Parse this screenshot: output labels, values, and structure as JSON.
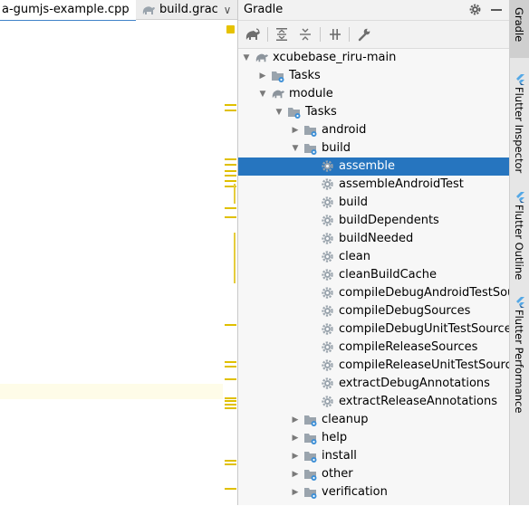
{
  "editor_tabs": [
    {
      "label": "a-gumjs-example.cpp",
      "active": true
    },
    {
      "label": "build.grac",
      "active": false
    }
  ],
  "tab_more_glyph": "∨",
  "gradle_panel": {
    "title": "Gradle",
    "toolbar": [
      "refresh-gradle-icon",
      "expand-all-icon",
      "collapse-all-icon",
      "link-project-icon",
      "gradle-settings-icon"
    ],
    "tree": [
      {
        "label": "xcubebase_riru-main",
        "depth": 0,
        "icon": "gradle-elephant-icon",
        "arrow": "expanded"
      },
      {
        "label": "Tasks",
        "depth": 1,
        "icon": "task-folder-icon",
        "arrow": "collapsed"
      },
      {
        "label": "module",
        "depth": 1,
        "icon": "gradle-elephant-icon",
        "arrow": "expanded"
      },
      {
        "label": "Tasks",
        "depth": 2,
        "icon": "task-folder-icon",
        "arrow": "expanded"
      },
      {
        "label": "android",
        "depth": 3,
        "icon": "task-folder-icon",
        "arrow": "collapsed"
      },
      {
        "label": "build",
        "depth": 3,
        "icon": "task-folder-icon",
        "arrow": "expanded"
      },
      {
        "label": "assemble",
        "depth": 4,
        "icon": "gear-icon",
        "arrow": "none",
        "selected": true
      },
      {
        "label": "assembleAndroidTest",
        "depth": 4,
        "icon": "gear-icon",
        "arrow": "none"
      },
      {
        "label": "build",
        "depth": 4,
        "icon": "gear-icon",
        "arrow": "none"
      },
      {
        "label": "buildDependents",
        "depth": 4,
        "icon": "gear-icon",
        "arrow": "none"
      },
      {
        "label": "buildNeeded",
        "depth": 4,
        "icon": "gear-icon",
        "arrow": "none"
      },
      {
        "label": "clean",
        "depth": 4,
        "icon": "gear-icon",
        "arrow": "none"
      },
      {
        "label": "cleanBuildCache",
        "depth": 4,
        "icon": "gear-icon",
        "arrow": "none"
      },
      {
        "label": "compileDebugAndroidTestSourc",
        "depth": 4,
        "icon": "gear-icon",
        "arrow": "none"
      },
      {
        "label": "compileDebugSources",
        "depth": 4,
        "icon": "gear-icon",
        "arrow": "none"
      },
      {
        "label": "compileDebugUnitTestSources",
        "depth": 4,
        "icon": "gear-icon",
        "arrow": "none"
      },
      {
        "label": "compileReleaseSources",
        "depth": 4,
        "icon": "gear-icon",
        "arrow": "none"
      },
      {
        "label": "compileReleaseUnitTestSources",
        "depth": 4,
        "icon": "gear-icon",
        "arrow": "none"
      },
      {
        "label": "extractDebugAnnotations",
        "depth": 4,
        "icon": "gear-icon",
        "arrow": "none"
      },
      {
        "label": "extractReleaseAnnotations",
        "depth": 4,
        "icon": "gear-icon",
        "arrow": "none"
      },
      {
        "label": "cleanup",
        "depth": 3,
        "icon": "task-folder-icon",
        "arrow": "collapsed"
      },
      {
        "label": "help",
        "depth": 3,
        "icon": "task-folder-icon",
        "arrow": "collapsed"
      },
      {
        "label": "install",
        "depth": 3,
        "icon": "task-folder-icon",
        "arrow": "collapsed"
      },
      {
        "label": "other",
        "depth": 3,
        "icon": "task-folder-icon",
        "arrow": "collapsed"
      },
      {
        "label": "verification",
        "depth": 3,
        "icon": "task-folder-icon",
        "arrow": "collapsed"
      }
    ]
  },
  "right_tool_tabs": [
    "Gradle",
    "Flutter Inspector",
    "Flutter Outline",
    "Flutter Performance"
  ],
  "colors": {
    "selection": "#2675bf",
    "accent": "#4083c9",
    "flutter_blue": "#54a8e6",
    "marker_yellow": "#e0c000"
  }
}
